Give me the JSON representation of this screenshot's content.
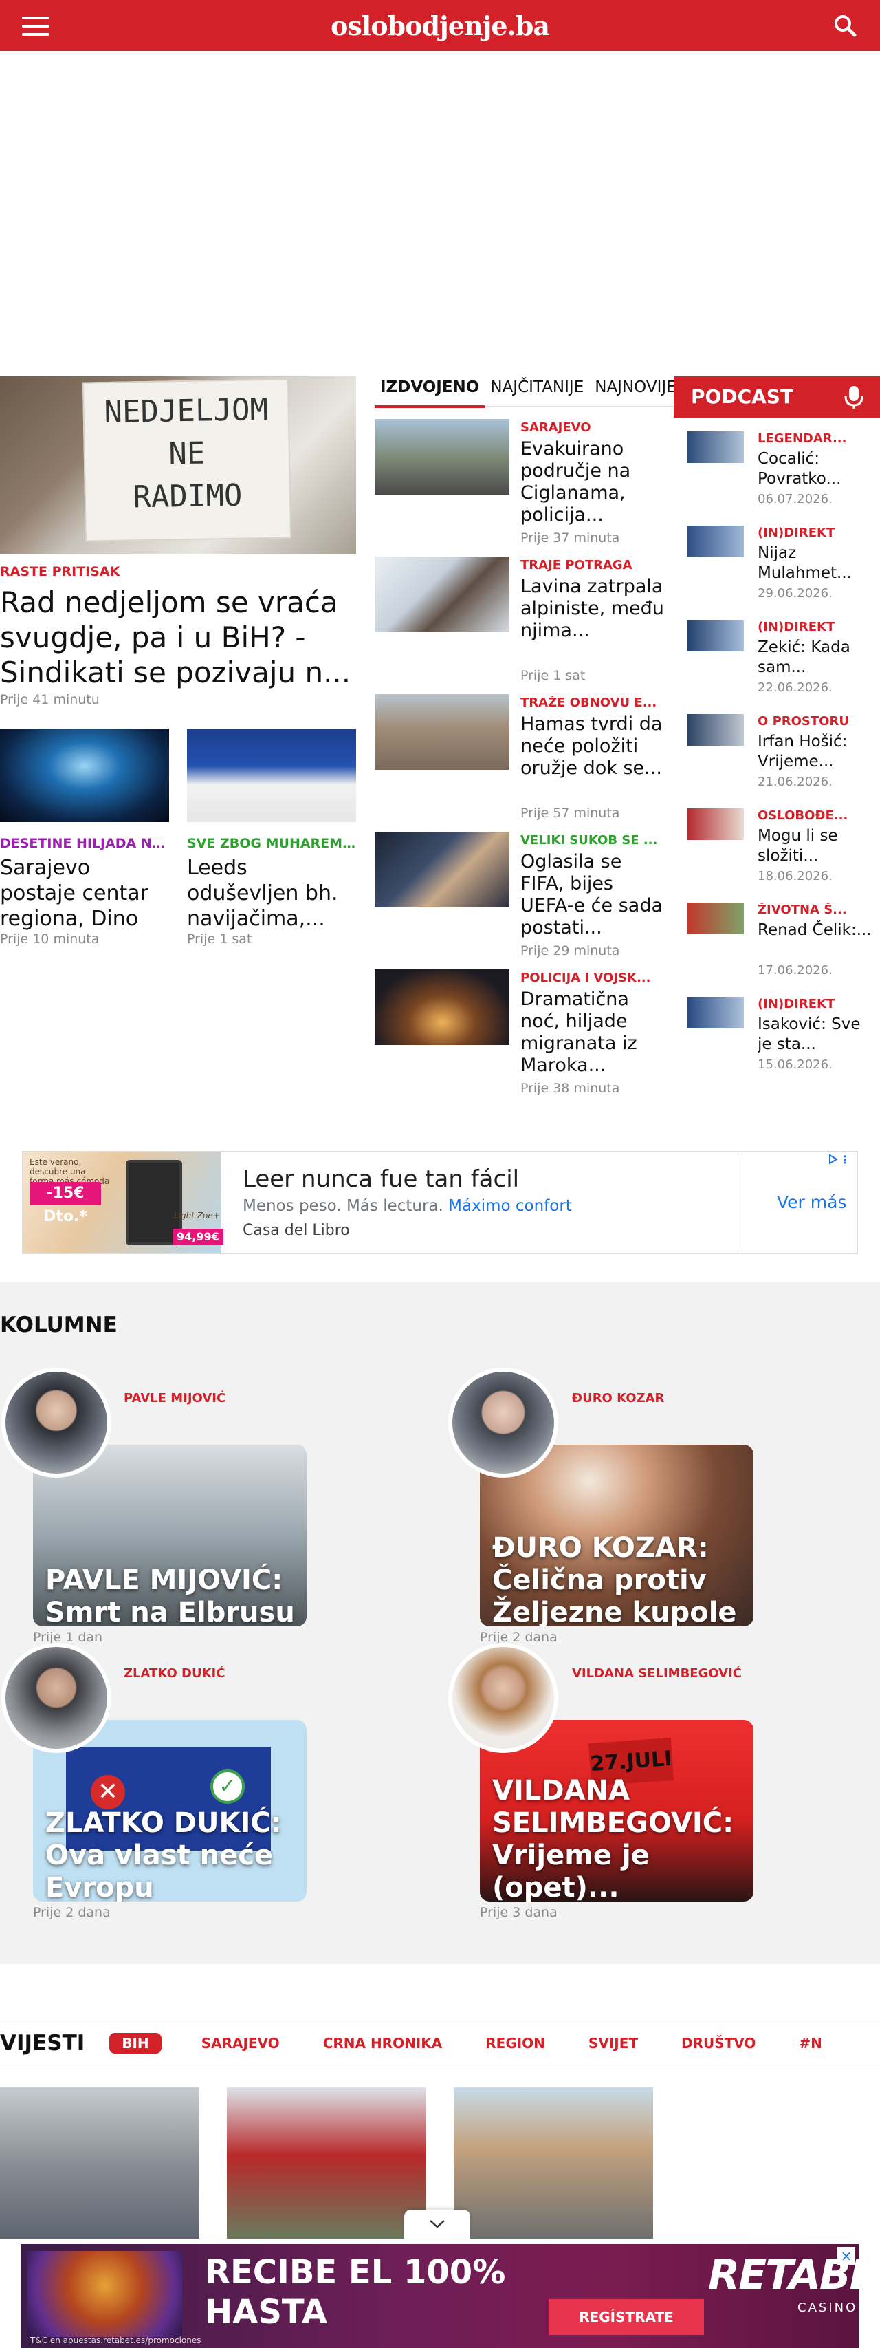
{
  "header": {
    "logo": "oslobodjenje.ba"
  },
  "lead": {
    "kicker": "RASTE PRITISAK",
    "title": "Rad nedjeljom se vraća svugdje, pa i u BiH? - Sindikati se pozivaju n...",
    "time": "Prije 41 minutu",
    "sign_text": [
      "NEDJELJOM",
      "NE",
      "RADIMO"
    ]
  },
  "small_cards": [
    {
      "kicker": "DESETINE HILJADA NA...",
      "kicker_color": "#9b1fb0",
      "title": "Sarajevo postaje centar regiona, Dino Merlin se...",
      "time": "Prije 10 minuta"
    },
    {
      "kicker": "SVE ZBOG MUHAREMO...",
      "kicker_color": "#2ea02e",
      "title": "Leeds oduševljen bh. navijačima,...",
      "time": "Prije 1 sat"
    }
  ],
  "tabs": [
    "IZDVOJENO",
    "NAJČITANIJE",
    "NAJNOVIJE"
  ],
  "featured": [
    {
      "kicker": "SARAJEVO",
      "kicker_color": "#d3212a",
      "title": "Evakuirano područje na Ciglanama, policija...",
      "time": "Prije 37 minuta"
    },
    {
      "kicker": "TRAJE POTRAGA",
      "kicker_color": "#d3212a",
      "title": "Lavina zatrpala alpiniste, među njima...",
      "time": "Prije 1 sat"
    },
    {
      "kicker": "TRAŽE OBNOVU E...",
      "kicker_color": "#d3212a",
      "title": "Hamas tvrdi da neće položiti oružje dok se...",
      "time": "Prije 57 minuta"
    },
    {
      "kicker": "VELIKI SUKOB SE ...",
      "kicker_color": "#2ea02e",
      "title": "Oglasila se FIFA, bijes UEFA-e će sada postati...",
      "time": "Prije 29 minuta"
    },
    {
      "kicker": "POLICIJA I VOJSK...",
      "kicker_color": "#d3212a",
      "title": "Dramatična noć, hiljade migranata iz Maroka...",
      "time": "Prije 38 minuta"
    }
  ],
  "podcast": {
    "title": "PODCAST",
    "items": [
      {
        "kicker": "LEGENDAR...",
        "title": "Cocalić: Povratko...",
        "date": "06.07.2026."
      },
      {
        "kicker": "(IN)DIREKT",
        "title": "Nijaz Mulahmet...",
        "date": "29.06.2026."
      },
      {
        "kicker": "(IN)DIREKT",
        "title": "Zekić: Kada sam...",
        "date": "22.06.2026."
      },
      {
        "kicker": "O PROSTORU",
        "title": "Irfan Hošić: Vrijeme...",
        "date": "21.06.2026."
      },
      {
        "kicker": "OSLOBOĐE...",
        "title": "Mogu li se složiti...",
        "date": "18.06.2026."
      },
      {
        "kicker": "ŽIVOTNA Š...",
        "title": "Renad Čelik:...",
        "date": "17.06.2026."
      },
      {
        "kicker": "(IN)DIREKT",
        "title": "Isaković: Sve je sta...",
        "date": "15.06.2026."
      }
    ]
  },
  "ad1": {
    "headline": "Leer nunca fue tan fácil",
    "sub": "Menos peso. Más lectura.",
    "sub_highlight": "Máximo confort",
    "brand": "Casa del Libro",
    "cta": "Ver más",
    "img_text": "Este verano, descubre una forma más cómoda de leer.",
    "badge": "-15€ Dto.*",
    "model": "Light Zoe+",
    "price": "94,99€"
  },
  "columns": {
    "title": "KOLUMNE",
    "items": [
      {
        "author": "PAVLE MIJOVIĆ",
        "caption": "PAVLE MIJOVIĆ: Smrt na Elbrusu",
        "time": "Prije 1 dan"
      },
      {
        "author": "ĐURO KOZAR",
        "caption": "ĐURO KOZAR: Čelična protiv Željezne kupole",
        "time": "Prije 2 dana"
      },
      {
        "author": "ZLATKO DUKIĆ",
        "caption": "ZLATKO DUKIĆ: Ova vlast neće Evropu",
        "time": "Prije 2 dana"
      },
      {
        "author": "VILDANA SELIMBEGOVIĆ",
        "caption": "VILDANA SELIMBEGOVIĆ: Vrijeme je (opet)...",
        "time": "Prije 3 dana",
        "banner": "27.JULI"
      }
    ]
  },
  "vijesti": {
    "title": "VIJESTI",
    "categories": [
      "BIH",
      "SARAJEVO",
      "CRNA HRONIKA",
      "REGION",
      "SVIJET",
      "DRUŠTVO",
      "#N"
    ]
  },
  "ad2": {
    "line1": "RECIBE EL 100%",
    "line2": "HASTA",
    "logo": "RETABET",
    "casino": "CASINO",
    "cta": "REGÍSTRATE",
    "legal": "T&C en apuestas.retabet.es/promociones"
  }
}
